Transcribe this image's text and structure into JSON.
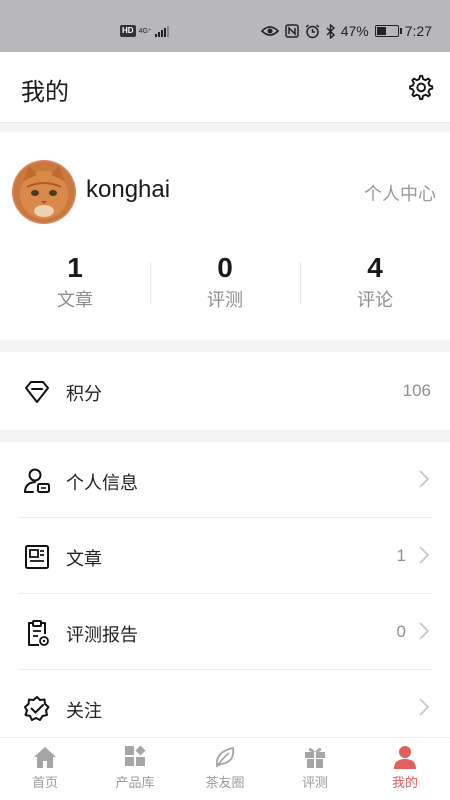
{
  "status_bar": {
    "hd": "HD",
    "network": "4G⁺",
    "battery_percent": "47%",
    "battery_level": 0.47,
    "time": "7:27"
  },
  "header": {
    "title": "我的"
  },
  "profile": {
    "username": "konghai",
    "center_link": "个人中心",
    "stats": [
      {
        "value": "1",
        "label": "文章"
      },
      {
        "value": "0",
        "label": "评测"
      },
      {
        "value": "4",
        "label": "评论"
      }
    ]
  },
  "points": {
    "label": "积分",
    "value": "106"
  },
  "menu": [
    {
      "label": "个人信息",
      "value": ""
    },
    {
      "label": "文章",
      "value": "1"
    },
    {
      "label": "评测报告",
      "value": "0"
    },
    {
      "label": "关注",
      "value": ""
    }
  ],
  "tabs": [
    {
      "label": "首页",
      "icon": "home-icon"
    },
    {
      "label": "产品库",
      "icon": "products-icon"
    },
    {
      "label": "茶友圈",
      "icon": "leaf-icon"
    },
    {
      "label": "评测",
      "icon": "gift-icon"
    },
    {
      "label": "我的",
      "icon": "person-icon"
    }
  ],
  "colors": {
    "accent": "#e06060",
    "muted": "#9a9a9a",
    "status_bar_bg": "#b8b8bc"
  }
}
